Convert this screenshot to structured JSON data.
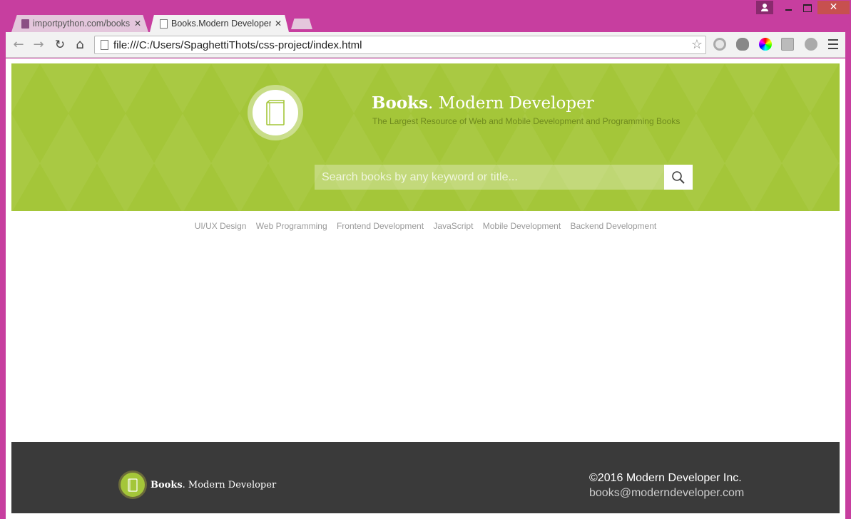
{
  "window": {
    "close_glyph": "✕"
  },
  "tabs": [
    {
      "label": "importpython.com/books",
      "active": false
    },
    {
      "label": "Books.Modern Developer",
      "active": true
    }
  ],
  "toolbar": {
    "back_glyph": "←",
    "forward_glyph": "→",
    "reload_glyph": "↻",
    "home_glyph": "⌂",
    "url": "file:///C:/Users/SpaghettiThots/css-project/index.html",
    "star_glyph": "☆"
  },
  "hero": {
    "brand_bold": "Books",
    "brand_rest": ". Modern Developer",
    "tagline": "The Largest Resource of Web and Mobile Development and Programming Books",
    "search_placeholder": "Search books by any keyword or title...",
    "accent_color": "#a4c639"
  },
  "categories": [
    "UI/UX Design",
    "Web Programming",
    "Frontend Development",
    "JavaScript",
    "Mobile Development",
    "Backend Development"
  ],
  "footer": {
    "brand_bold": "Books",
    "brand_rest": ". Modern Developer",
    "copyright": "©2016 Modern Developer Inc.",
    "email": "books@moderndeveloper.com",
    "background_color": "#3a3a3a"
  },
  "icons": [
    "user-icon",
    "minimize-icon",
    "maximize-icon",
    "close-icon",
    "page-icon",
    "book-icon",
    "search-icon",
    "star-icon",
    "menu-icon"
  ]
}
